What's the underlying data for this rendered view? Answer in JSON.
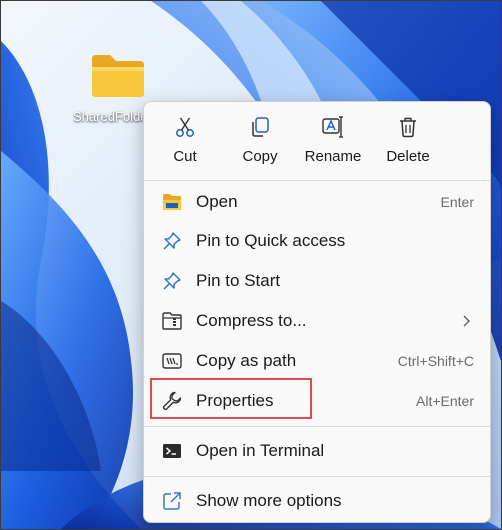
{
  "desktop": {
    "folder_label": "SharedFolder",
    "folder_icon": "folder-icon"
  },
  "context_menu": {
    "quick_actions": [
      {
        "label": "Cut",
        "icon": "scissors-icon"
      },
      {
        "label": "Copy",
        "icon": "copy-icon"
      },
      {
        "label": "Rename",
        "icon": "rename-icon"
      },
      {
        "label": "Delete",
        "icon": "trash-icon"
      }
    ],
    "items": [
      {
        "label": "Open",
        "shortcut": "Enter",
        "icon": "folder-icon"
      },
      {
        "label": "Pin to Quick access",
        "shortcut": "",
        "icon": "pin-icon"
      },
      {
        "label": "Pin to Start",
        "shortcut": "",
        "icon": "pin-icon"
      },
      {
        "label": "Compress to...",
        "shortcut": "",
        "icon": "zip-folder-icon",
        "has_submenu": true
      },
      {
        "label": "Copy as path",
        "shortcut": "Ctrl+Shift+C",
        "icon": "copy-path-icon"
      },
      {
        "label": "Properties",
        "shortcut": "Alt+Enter",
        "icon": "wrench-icon",
        "highlighted": true
      },
      {
        "label": "Open in Terminal",
        "shortcut": "",
        "icon": "terminal-icon"
      },
      {
        "label": "Show more options",
        "shortcut": "",
        "icon": "external-link-icon"
      }
    ]
  },
  "colors": {
    "highlight_border": "#e04a4a",
    "menu_background": "#f9f9f9",
    "icon_blue": "#3a76c4",
    "folder_yellow": "#f8c83c"
  }
}
